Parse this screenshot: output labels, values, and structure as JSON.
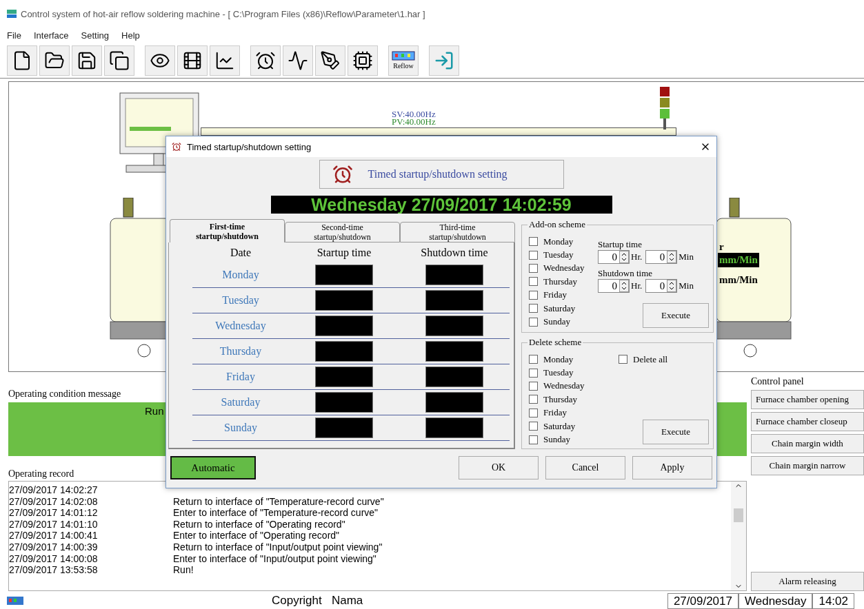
{
  "window": {
    "title": "Control system of hot-air reflow soldering machine - [ C:\\Program Files (x86)\\Reflow\\Parameter\\1.har ]"
  },
  "menu": [
    "File",
    "Interface",
    "Setting",
    "Help"
  ],
  "toolbar": {
    "reflow_label": "Reflow"
  },
  "machine": {
    "sv": "SV:40.00Hz",
    "pv": "PV:40.00Hz",
    "speed_label": "r",
    "speed_set": "mm/Min",
    "speed_actual": "mm/Min"
  },
  "condition": {
    "legend": "Operating condition message",
    "status": "Run"
  },
  "record": {
    "legend": "Operating record",
    "rows": [
      {
        "time": "27/09/2017 14:02:27"
      },
      {
        "time": "27/09/2017 14:02:08",
        "message": "Return to interface of \"Temperature-record curve\""
      },
      {
        "time": "27/09/2017 14:01:12",
        "message": "Enter to interface of \"Temperature-record curve\""
      },
      {
        "time": "27/09/2017 14:01:10",
        "message": "Return to interface of \"Operating record\""
      },
      {
        "time": "27/09/2017 14:00:41",
        "message": "Enter to interface of \"Operating record\""
      },
      {
        "time": "27/09/2017 14:00:39",
        "message": "Return to interface of \"Input/output point viewing\""
      },
      {
        "time": "27/09/2017 14:00:08",
        "message": "Enter to interface of \"Input/output point viewing\""
      },
      {
        "time": "27/09/2017 13:53:58",
        "message": "Run!"
      }
    ]
  },
  "control_panel": {
    "legend": "Control panel",
    "buttons": [
      "Furnace chamber opening",
      "Furnace chamber closeup",
      "Chain margin width",
      "Chain margin narrow"
    ],
    "alarm_button": "Alarm releasing"
  },
  "status_bar": {
    "copyright": "Copyright   Nama",
    "date": "27/09/2017",
    "weekday": "Wednesday",
    "time": "14:02"
  },
  "dialog": {
    "title": "Timed startup/shutdown setting",
    "header": "Timed startup/shutdown setting",
    "clock": "Wednesday 27/09/2017 14:02:59",
    "tabs": [
      {
        "label": "First-time startup/shutdown",
        "selected": true
      },
      {
        "label": "Second-time startup/shutdown",
        "selected": false
      },
      {
        "label": "Third-time startup/shutdown",
        "selected": false
      }
    ],
    "columns": [
      "Date",
      "Startup time",
      "Shutdown time"
    ],
    "days": [
      "Monday",
      "Tuesday",
      "Wednesday",
      "Thursday",
      "Friday",
      "Saturday",
      "Sunday"
    ],
    "add_on": {
      "legend": "Add-on scheme",
      "days": [
        {
          "label": "Monday",
          "checked": false
        },
        {
          "label": "Tuesday",
          "checked": false
        },
        {
          "label": "Wednesday",
          "checked": false
        },
        {
          "label": "Thursday",
          "checked": false
        },
        {
          "label": "Friday",
          "checked": false
        },
        {
          "label": "Saturday",
          "checked": false
        },
        {
          "label": "Sunday",
          "checked": false
        }
      ],
      "startup_label": "Startup time",
      "startup_hr": "0",
      "startup_hr_unit": "Hr.",
      "startup_min": "0",
      "startup_min_unit": "Min",
      "shutdown_label": "Shutdown time",
      "shutdown_hr": "0",
      "shutdown_hr_unit": "Hr.",
      "shutdown_min": "0",
      "shutdown_min_unit": "Min",
      "execute": "Execute"
    },
    "delete": {
      "legend": "Delete scheme",
      "days": [
        {
          "label": "Monday",
          "checked": false
        },
        {
          "label": "Tuesday",
          "checked": false
        },
        {
          "label": "Wednesday",
          "checked": false
        },
        {
          "label": "Thursday",
          "checked": false
        },
        {
          "label": "Friday",
          "checked": false
        },
        {
          "label": "Saturday",
          "checked": false
        },
        {
          "label": "Sunday",
          "checked": false
        }
      ],
      "delete_all": {
        "label": "Delete all",
        "checked": false
      },
      "execute": "Execute"
    },
    "automatic": {
      "label": "Automatic",
      "on": true
    },
    "buttons": [
      "OK",
      "Cancel",
      "Apply"
    ]
  }
}
